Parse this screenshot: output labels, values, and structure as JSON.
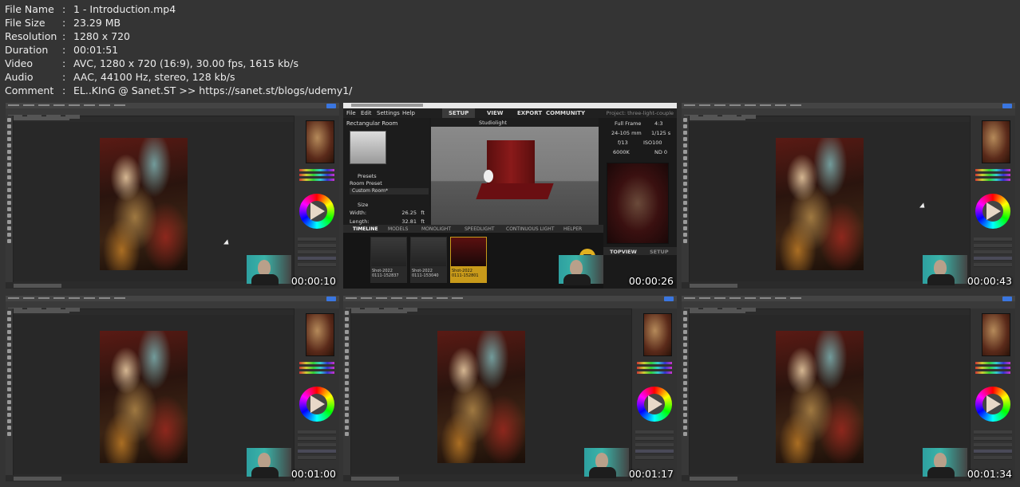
{
  "meta": {
    "rows": [
      {
        "key": "File Name",
        "value": "1 - Introduction.mp4"
      },
      {
        "key": "File Size",
        "value": "23.29 MB"
      },
      {
        "key": "Resolution",
        "value": "1280 x 720"
      },
      {
        "key": "Duration",
        "value": "00:01:51"
      },
      {
        "key": "Video",
        "value": "AVC, 1280 x 720 (16:9), 30.00 fps, 1615 kb/s"
      },
      {
        "key": "Audio",
        "value": "AAC, 44100 Hz, stereo, 128 kb/s"
      },
      {
        "key": "Comment",
        "value": "EL..KInG @ Sanet.ST >> https://sanet.st/blogs/udemy1/"
      }
    ],
    "separator": ":"
  },
  "thumbnails": [
    {
      "timestamp": "00:00:10",
      "app": "photoshop"
    },
    {
      "timestamp": "00:00:26",
      "app": "studiolight"
    },
    {
      "timestamp": "00:00:43",
      "app": "photoshop"
    },
    {
      "timestamp": "00:01:00",
      "app": "photoshop"
    },
    {
      "timestamp": "00:01:17",
      "app": "photoshop"
    },
    {
      "timestamp": "00:01:34",
      "app": "photoshop"
    }
  ],
  "studio": {
    "menu": [
      "File",
      "Edit",
      "Settings",
      "Help"
    ],
    "tabs": [
      "SETUP",
      "VIEW",
      "EXPORT",
      "COMMUNITY"
    ],
    "project": "Project: three-light-couple",
    "left": {
      "title": "Rectangular Room",
      "presets": "Presets",
      "room_preset": "Room Preset",
      "room_value": "Custom Room*",
      "size": "Size",
      "width_label": "Width:",
      "width_value": "26.25",
      "width_unit": "ft",
      "length_label": "Length:",
      "length_value": "32.81",
      "length_unit": "ft"
    },
    "toolbar_label": "Studiolight",
    "camera": {
      "frame": "Full Frame",
      "ratio": "4:3",
      "lens": "24-105 mm",
      "shutter": "1/125 s",
      "aperture": "f/13",
      "iso": "ISO100",
      "wb": "6000K",
      "nd": "ND 0"
    },
    "timeline_tabs": [
      "TIMELINE",
      "MODELS",
      "MONOLIGHT",
      "SPEEDLIGHT",
      "CONTINUOUS LIGHT",
      "HELPER"
    ],
    "shots": [
      {
        "name": "Shot-2022",
        "id": "0111-152837"
      },
      {
        "name": "Shot-2022",
        "id": "0111-153040"
      },
      {
        "name": "Shot-2022",
        "id": "0111-152801"
      }
    ],
    "bottom_tabs": [
      "TOPVIEW",
      "SETUP"
    ]
  }
}
